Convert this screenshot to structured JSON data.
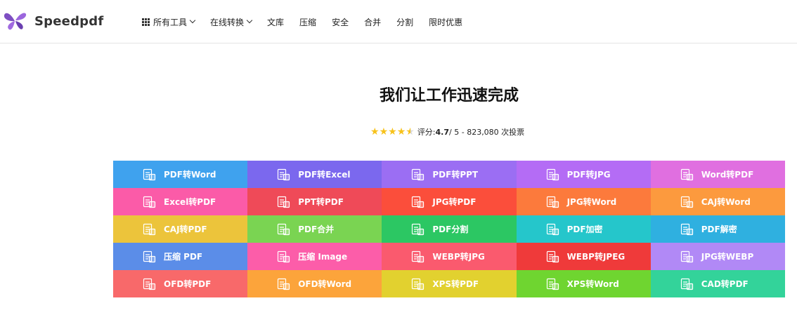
{
  "header": {
    "logo_text": "Speedpdf",
    "nav": [
      {
        "label": "所有工具",
        "has_grid_icon": true,
        "has_dropdown": true
      },
      {
        "label": "在线转换",
        "has_grid_icon": false,
        "has_dropdown": true
      },
      {
        "label": "文库"
      },
      {
        "label": "压缩"
      },
      {
        "label": "安全"
      },
      {
        "label": "合并"
      },
      {
        "label": "分割"
      },
      {
        "label": "限时优惠"
      }
    ]
  },
  "hero": {
    "title": "我们让工作迅速完成",
    "rating": {
      "prefix": "评分: ",
      "score": "4.7",
      "suffix": " / 5 - 823,080 次投票",
      "stars": 4.5
    }
  },
  "tools": [
    {
      "label": "PDF转Word",
      "color": "#3fa2ee",
      "icon": "pdf-file-icon"
    },
    {
      "label": "PDF转Excel",
      "color": "#7b68ee",
      "icon": "pdf-file-icon"
    },
    {
      "label": "PDF转PPT",
      "color": "#9b6ef3",
      "icon": "pdf-file-icon"
    },
    {
      "label": "PDF转JPG",
      "color": "#b46cf5",
      "icon": "pdf-file-icon"
    },
    {
      "label": "Word转PDF",
      "color": "#e06fe0",
      "icon": "word-file-icon"
    },
    {
      "label": "Excel转PDF",
      "color": "#fb5ba8",
      "icon": "excel-file-icon"
    },
    {
      "label": "PPT转PDF",
      "color": "#ef4a58",
      "icon": "ppt-file-icon"
    },
    {
      "label": "JPG转PDF",
      "color": "#fb4e3b",
      "icon": "image-file-icon"
    },
    {
      "label": "JPG转Word",
      "color": "#fc7a3c",
      "icon": "image-file-icon"
    },
    {
      "label": "CAJ转Word",
      "color": "#fc9a3e",
      "icon": "caj-file-icon"
    },
    {
      "label": "CAJ转PDF",
      "color": "#ecc43b",
      "icon": "caj-file-icon"
    },
    {
      "label": "PDF合并",
      "color": "#7ad452",
      "icon": "merge-icon"
    },
    {
      "label": "PDF分割",
      "color": "#2cc763",
      "icon": "split-icon"
    },
    {
      "label": "PDF加密",
      "color": "#25c6cb",
      "icon": "lock-file-icon"
    },
    {
      "label": "PDF解密",
      "color": "#2fb0e0",
      "icon": "unlock-file-icon"
    },
    {
      "label": "压缩 PDF",
      "color": "#5b8de8",
      "icon": "compress-pdf-icon"
    },
    {
      "label": "压缩 Image",
      "color": "#fc5da9",
      "icon": "compress-image-icon"
    },
    {
      "label": "WEBP转JPG",
      "color": "#fa5a6e",
      "icon": "image-file-icon"
    },
    {
      "label": "WEBP转JPEG",
      "color": "#ef3a3a",
      "icon": "image-file-icon"
    },
    {
      "label": "JPG转WEBP",
      "color": "#b189f6",
      "icon": "image-file-icon"
    },
    {
      "label": "OFD转PDF",
      "color": "#f8696a",
      "icon": "ofd-file-icon"
    },
    {
      "label": "OFD转Word",
      "color": "#fca43b",
      "icon": "ofd-file-icon"
    },
    {
      "label": "XPS转PDF",
      "color": "#e2d12f",
      "icon": "xps-file-icon"
    },
    {
      "label": "XPS转Word",
      "color": "#6fd530",
      "icon": "xps-file-icon"
    },
    {
      "label": "CAD转PDF",
      "color": "#33d39a",
      "icon": "cad-file-icon"
    }
  ]
}
